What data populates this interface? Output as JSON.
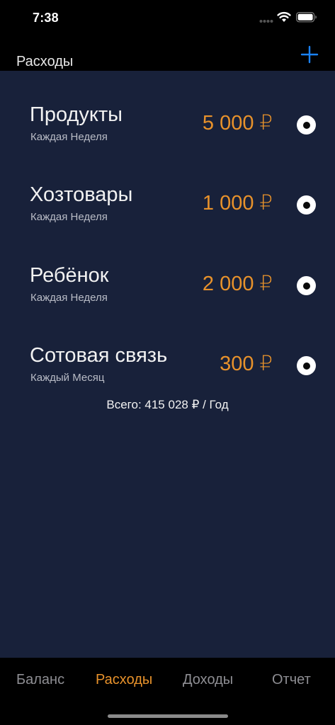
{
  "status": {
    "time": "7:38"
  },
  "nav": {
    "title": "Расходы"
  },
  "expenses": [
    {
      "title": "Продукты",
      "period": "Каждая Неделя",
      "amount": "5 000 ₽"
    },
    {
      "title": "Хозтовары",
      "period": "Каждая Неделя",
      "amount": "1 000 ₽"
    },
    {
      "title": "Ребёнок",
      "period": "Каждая Неделя",
      "amount": "2 000 ₽"
    },
    {
      "title": "Сотовая связь",
      "period": "Каждый Месяц",
      "amount": "300 ₽"
    }
  ],
  "total": "Всего: 415 028 ₽ / Год",
  "tabs": [
    {
      "label": "Баланс",
      "active": false
    },
    {
      "label": "Расходы",
      "active": true
    },
    {
      "label": "Доходы",
      "active": false
    },
    {
      "label": "Отчет",
      "active": false
    }
  ],
  "colors": {
    "accent": "#e8922b",
    "add_button": "#1a82f7",
    "background": "#18213a",
    "bars": "#000000"
  },
  "icons": {
    "add": "plus-icon",
    "signal": "cellular-signal-icon",
    "wifi": "wifi-icon",
    "battery": "battery-icon"
  }
}
